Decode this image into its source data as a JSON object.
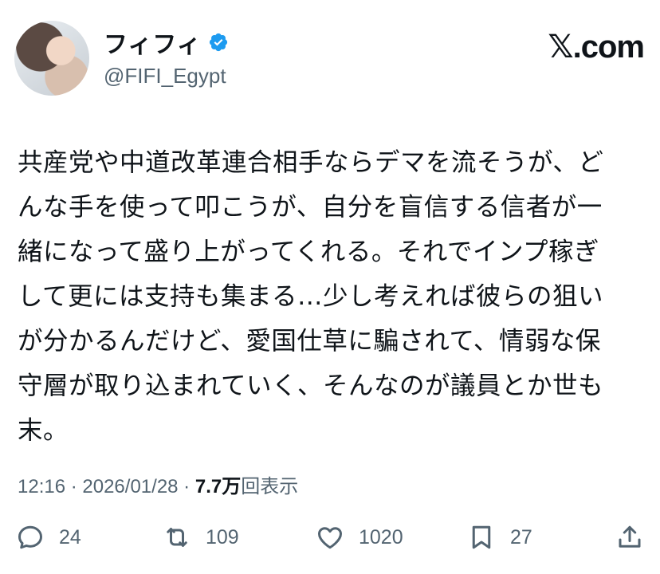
{
  "author": {
    "display_name": "フィフィ",
    "handle": "@FIFI_Egypt",
    "verified_icon": "verified-badge-icon",
    "badge_color": "#1d9bf0"
  },
  "brand": {
    "x_mark": "𝕏",
    "domain": ".com"
  },
  "tweet": {
    "line1": "共産党や中道改革連合相手ならデマを流そうが、ど",
    "line2": "んな手を使って叩こうが、自分を盲信する信者が一",
    "line3": "緒になって盛り上がってくれる。それでインプ稼ぎ",
    "line4": "して更には支持も集まる…少し考えれば彼らの狙い",
    "line5": "が分かるんだけど、愛国仕草に騙されて、情弱な保",
    "line6": "守層が取り込まれていく、そんなのが議員とか世も",
    "line7": "末。"
  },
  "meta": {
    "time": "12:16",
    "separator1": " · ",
    "date": "2026/01/28",
    "separator2": " · ",
    "views_count": "7.7万",
    "views_label": "回表示"
  },
  "actions": {
    "replies": "24",
    "reposts": "109",
    "likes": "1020",
    "bookmarks": "27"
  }
}
